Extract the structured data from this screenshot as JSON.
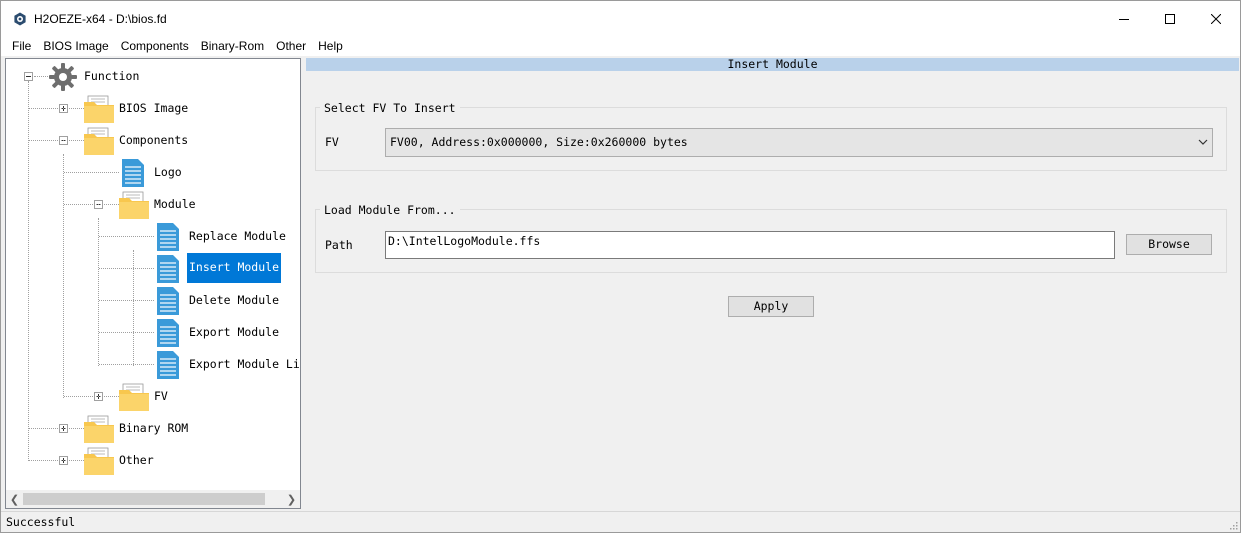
{
  "window": {
    "title": "H2OEZE-x64  -  D:\\bios.fd",
    "icon": "gear-app-icon"
  },
  "menu": {
    "items": [
      "File",
      "BIOS Image",
      "Components",
      "Binary-Rom",
      "Other",
      "Help"
    ]
  },
  "tree": {
    "root": "Function",
    "bios_image": "BIOS Image",
    "components": "Components",
    "logo": "Logo",
    "module": "Module",
    "replace_module": "Replace Module",
    "insert_module": "Insert Module",
    "delete_module": "Delete Module",
    "export_module": "Export Module",
    "export_module_list": "Export Module List",
    "fv": "FV",
    "binary_rom": "Binary ROM",
    "other": "Other",
    "selected": "Insert Module"
  },
  "content": {
    "header": "Insert Module",
    "fv_group": {
      "legend": "Select FV To Insert",
      "label": "FV",
      "selected_value": "FV00, Address:0x000000, Size:0x260000 bytes"
    },
    "load_group": {
      "legend": "Load Module From...",
      "label": "Path",
      "path_value": "D:\\IntelLogoModule.ffs",
      "browse_label": "Browse"
    },
    "apply_label": "Apply"
  },
  "status": {
    "text": "Successful"
  },
  "colors": {
    "selection": "#0078d7",
    "header_band": "#b9d1ea",
    "folder": "#f8c74e",
    "document": "#3a9ad9"
  }
}
